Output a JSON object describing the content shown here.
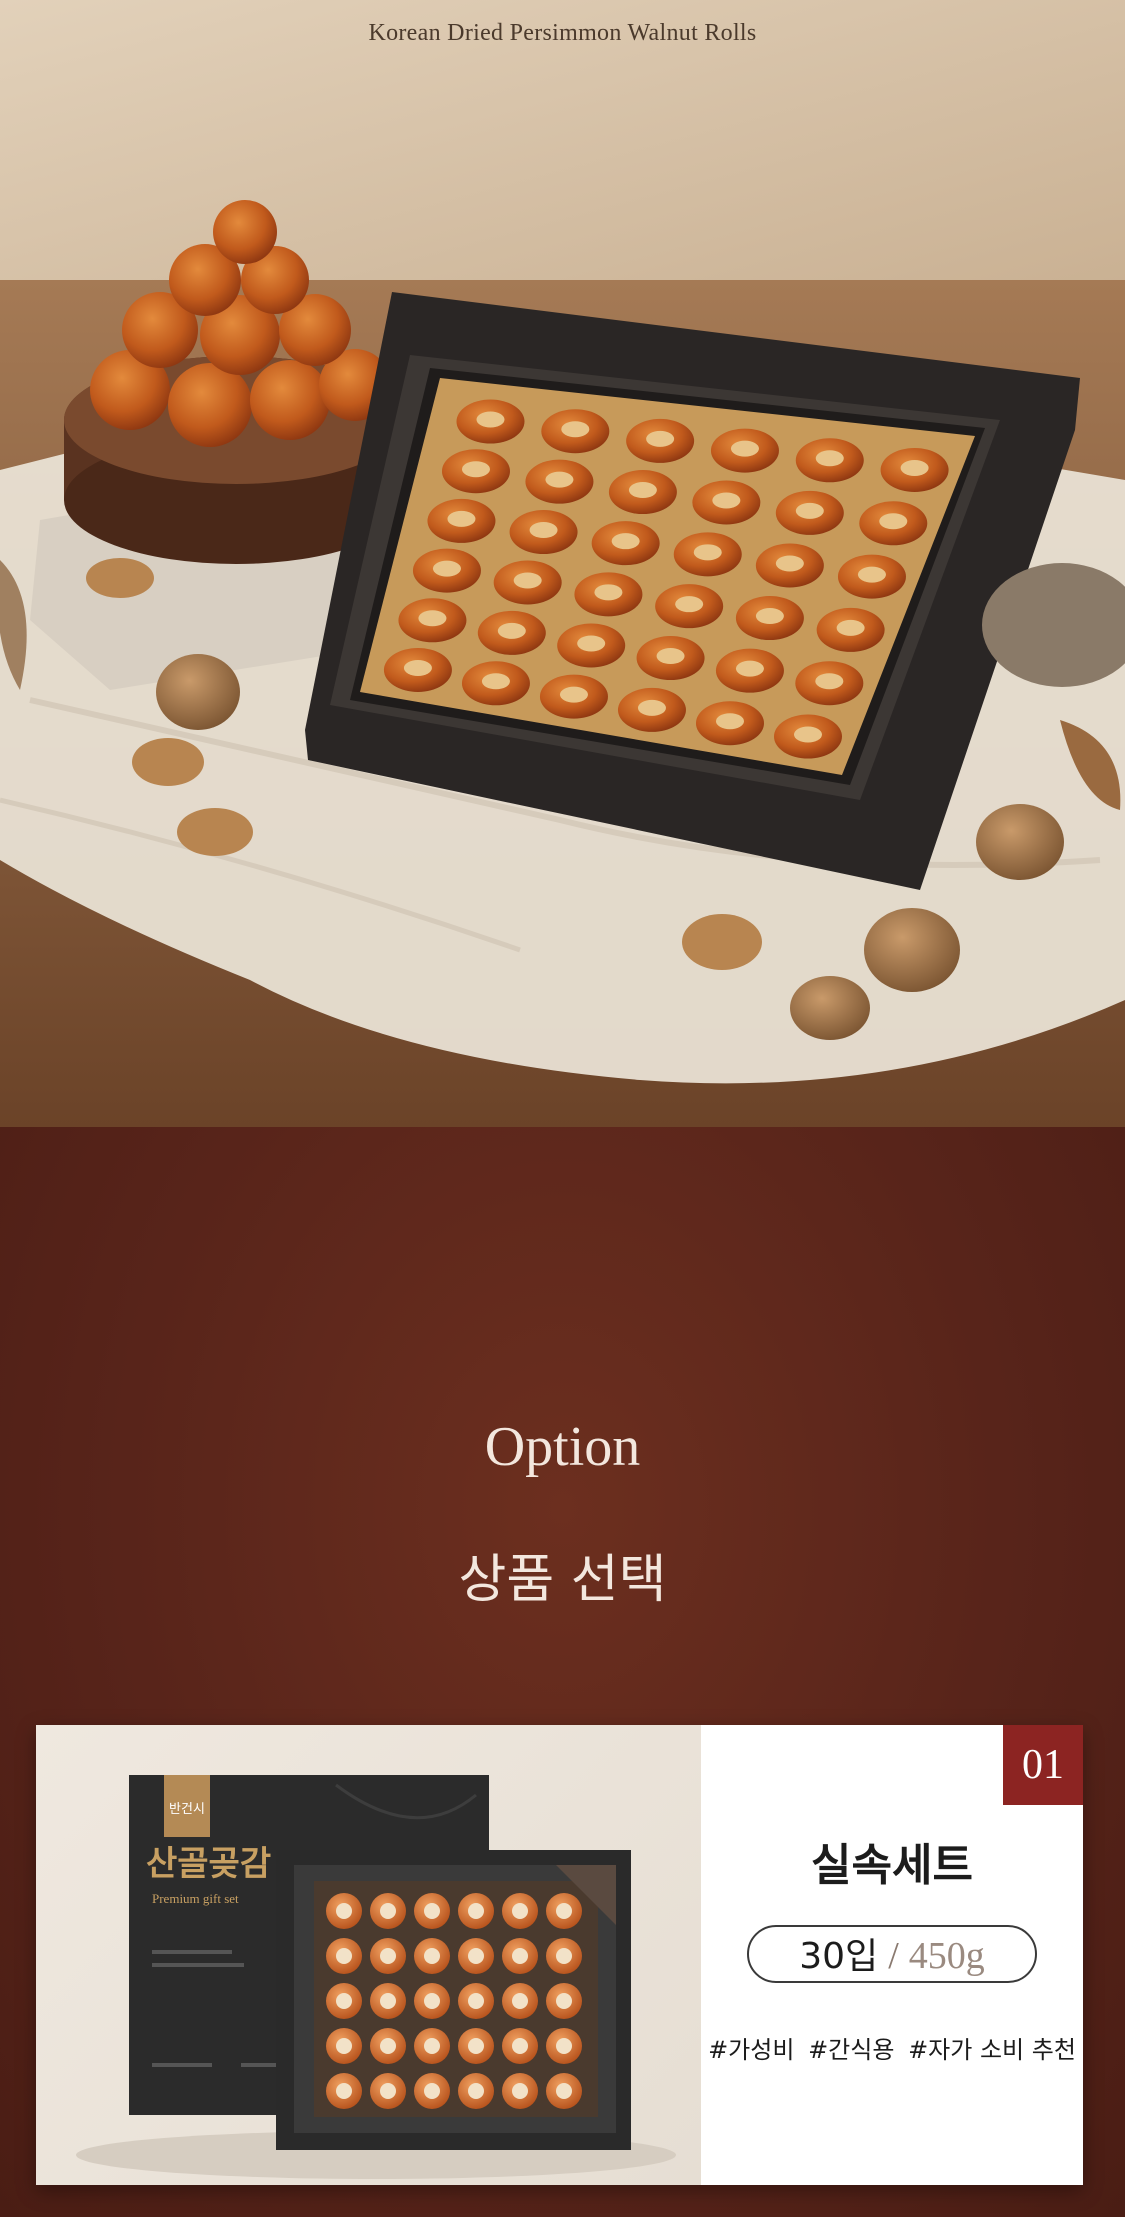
{
  "hero": {
    "title": "Korean Dried Persimmon Walnut Rolls"
  },
  "option": {
    "title_en": "Option",
    "title_ko": "상품 선택"
  },
  "product": {
    "number": "01",
    "name": "실속세트",
    "pieces": "30입",
    "separator": "/",
    "weight": "450g",
    "tags": [
      "#가성비",
      "#간식용",
      "#자가 소비 추천"
    ],
    "box_brand": "반건시",
    "box_title": "산골곶감",
    "box_subtitle": "Premium gift set"
  },
  "colors": {
    "section_bg": "#58241a",
    "badge": "#8c2422",
    "persimmon": "#c8601e",
    "box": "#2e2b29"
  }
}
